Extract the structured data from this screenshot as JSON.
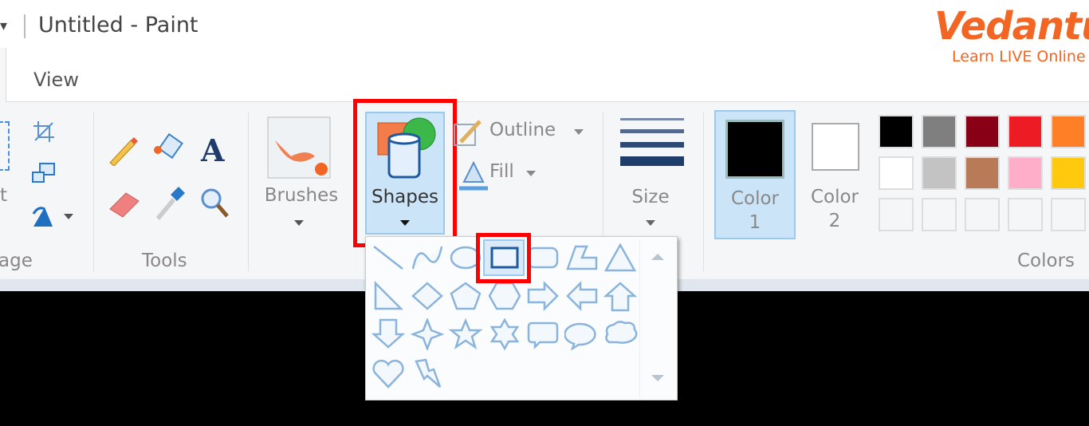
{
  "window": {
    "title": "Untitled - Paint"
  },
  "tabs": [
    {
      "label": "View"
    }
  ],
  "groups": {
    "image": "age",
    "image_select_partial": "t",
    "tools": "Tools",
    "colors": "Colors"
  },
  "buttons": {
    "brushes": "Brushes",
    "shapes": "Shapes",
    "outline": "Outline",
    "fill": "Fill",
    "size": "Size",
    "color1": "Color\n1",
    "color1_a": "Color",
    "color1_b": "1",
    "color2_a": "Color",
    "color2_b": "2"
  },
  "shapes_gallery": {
    "items": [
      "line",
      "curve",
      "oval",
      "rectangle",
      "rounded-rectangle",
      "polygon",
      "triangle",
      "right-triangle",
      "diamond",
      "pentagon",
      "hexagon",
      "right-arrow",
      "left-arrow",
      "up-arrow",
      "down-arrow",
      "four-point-star",
      "five-point-star",
      "six-point-star",
      "rounded-callout",
      "oval-callout",
      "cloud-callout",
      "heart",
      "lightning"
    ],
    "selected": "rectangle"
  },
  "palette": {
    "color1": "#000000",
    "color2": "#ffffff",
    "swatches": [
      "#000000",
      "#7f7f7f",
      "#880015",
      "#ed1c24",
      "#ff7f27",
      "#ffffff",
      "#c3c3c3",
      "#b97a57",
      "#ffaec9",
      "#ffc90e",
      "",
      "",
      "",
      "",
      ""
    ]
  },
  "highlight_color": "#ff0000",
  "logo": {
    "brand": "Vedantu",
    "tagline": "Learn LIVE Online"
  }
}
